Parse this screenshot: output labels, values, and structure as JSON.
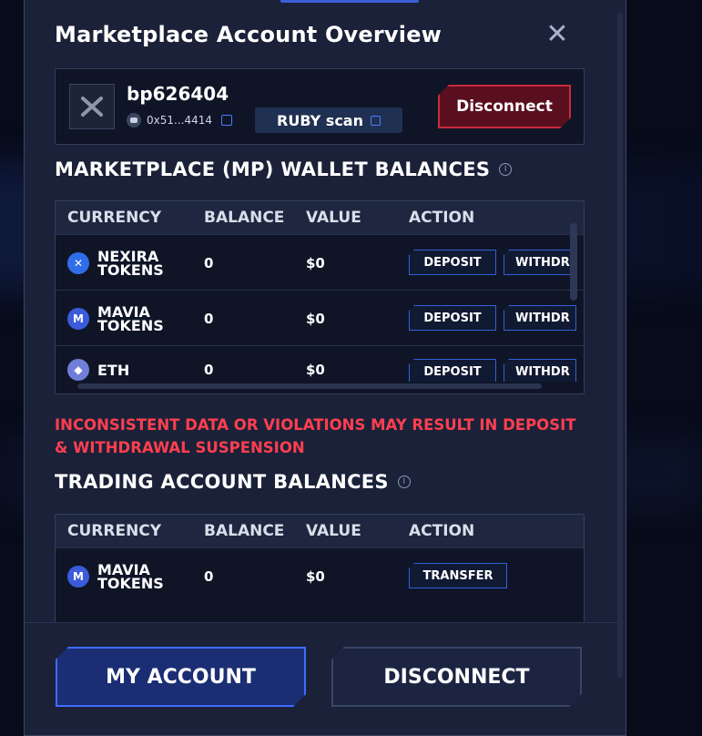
{
  "modal": {
    "title": "Marketplace Account Overview",
    "close_icon": "close-icon"
  },
  "account": {
    "username": "bp626404",
    "address": "0x51...4414",
    "ruby_scan_label": "RUBY scan",
    "disconnect_label": "Disconnect"
  },
  "mp_wallet": {
    "title": "Marketplace (MP) Wallet Balances",
    "headers": [
      "Currency",
      "Balance",
      "Value",
      "Action"
    ],
    "rows": [
      {
        "currency": "Nexira Tokens",
        "icon": "nexira-icon",
        "balance": "0",
        "value": "$0",
        "deposit": "Deposit",
        "withdraw": "Withdr"
      },
      {
        "currency": "Mavia Tokens",
        "icon": "mavia-icon",
        "balance": "0",
        "value": "$0",
        "deposit": "Deposit",
        "withdraw": "Withdr"
      },
      {
        "currency": "ETH",
        "icon": "eth-icon",
        "balance": "0",
        "value": "$0",
        "deposit": "Deposit",
        "withdraw": "Withdr"
      }
    ]
  },
  "warning": "Inconsistent data or violations may result in deposit & withdrawal suspension",
  "trading": {
    "title": "Trading Account Balances",
    "headers": [
      "Currency",
      "Balance",
      "Value",
      "Action"
    ],
    "rows": [
      {
        "currency": "Mavia Tokens",
        "icon": "mavia-icon",
        "balance": "0",
        "value": "$0",
        "action": "Transfer"
      }
    ]
  },
  "footer": {
    "my_account_label": "My Account",
    "disconnect_label": "Disconnect"
  },
  "colors": {
    "accent": "#3f6cff",
    "danger": "#ff3f4f",
    "modal_bg": "#1a2138"
  }
}
